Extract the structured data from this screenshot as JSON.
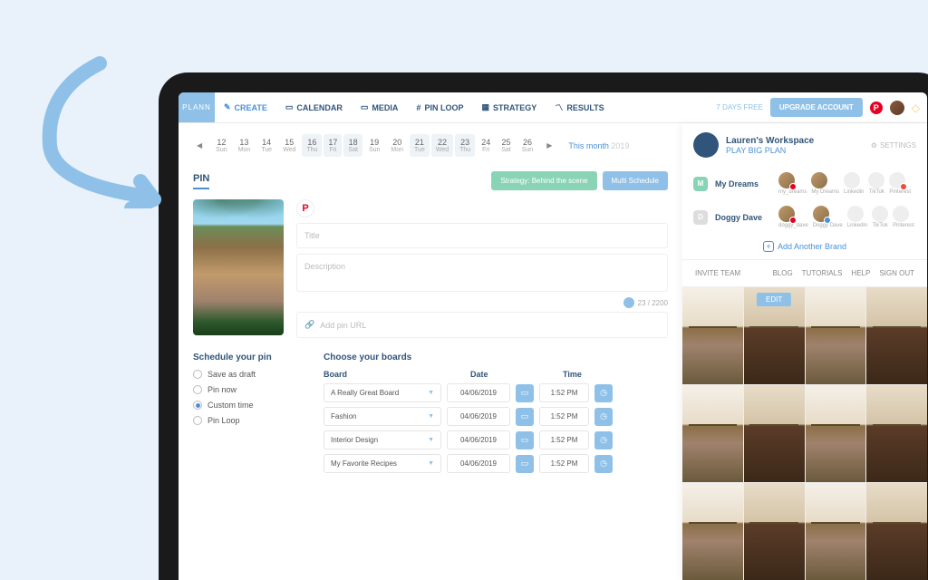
{
  "app": {
    "logo": "PLANN"
  },
  "nav": {
    "create": "CREATE",
    "calendar": "CALENDAR",
    "media": "MEDIA",
    "pinloop": "PIN LOOP",
    "strategy": "STRATEGY",
    "results": "RESULTS"
  },
  "account": {
    "freedays": "7 DAYS FREE",
    "upgrade": "UPGRADE ACCOUNT"
  },
  "dates": {
    "items": [
      {
        "n": "12",
        "d": "Sun"
      },
      {
        "n": "13",
        "d": "Mon"
      },
      {
        "n": "14",
        "d": "Tue"
      },
      {
        "n": "15",
        "d": "Wed"
      },
      {
        "n": "16",
        "d": "Thu",
        "sel": true
      },
      {
        "n": "17",
        "d": "Fri",
        "sel": true
      },
      {
        "n": "18",
        "d": "Sat",
        "sel": true
      },
      {
        "n": "19",
        "d": "Sun"
      },
      {
        "n": "20",
        "d": "Mon"
      },
      {
        "n": "21",
        "d": "Tue",
        "sel": true
      },
      {
        "n": "22",
        "d": "Wed",
        "sel": true
      },
      {
        "n": "23",
        "d": "Thu",
        "sel": true
      },
      {
        "n": "24",
        "d": "Fri"
      },
      {
        "n": "25",
        "d": "Sat"
      },
      {
        "n": "26",
        "d": "Sun"
      }
    ],
    "thismonth": "This month",
    "year": "2019"
  },
  "pin": {
    "heading": "PIN",
    "strategy_btn": "Strategy: Behind the scene",
    "multi_btn": "Multi Schedule",
    "title_ph": "Title",
    "desc_ph": "Description",
    "counter": "23 / 2200",
    "url_ph": "Add pin URL"
  },
  "schedule": {
    "heading": "Schedule your pin",
    "options": [
      "Save as draft",
      "Pin now",
      "Custom time",
      "Pin Loop"
    ],
    "selected": 2
  },
  "boards": {
    "heading": "Choose your boards",
    "cols": {
      "board": "Board",
      "date": "Date",
      "time": "Time"
    },
    "rows": [
      {
        "board": "A Really Great Board",
        "date": "04/06/2019",
        "time": "1:52 PM"
      },
      {
        "board": "Fashion",
        "date": "04/06/2019",
        "time": "1:52 PM"
      },
      {
        "board": "Interior Design",
        "date": "04/06/2019",
        "time": "1:52 PM"
      },
      {
        "board": "My Favorite Recipes",
        "date": "04/06/2019",
        "time": "1:52 PM"
      }
    ]
  },
  "workspace": {
    "name": "Lauren's Workspace",
    "plan": "PLAY BIG PLAN",
    "settings": "SETTINGS",
    "brands": [
      {
        "letter": "M",
        "name": "My Dreams",
        "cls": "g",
        "socials": [
          {
            "l": "my_dreams",
            "a": true,
            "b": "pk"
          },
          {
            "l": "My Dreams",
            "a": true
          },
          {
            "l": "Linkedin"
          },
          {
            "l": "TikTok"
          },
          {
            "l": "Pinterest",
            "b": "rd"
          }
        ]
      },
      {
        "letter": "D",
        "name": "Doggy Dave",
        "cls": "y",
        "socials": [
          {
            "l": "doggy_dave",
            "a": true,
            "b": "pk"
          },
          {
            "l": "Doggy Dave",
            "a": true,
            "b": "bl"
          },
          {
            "l": "Linkedin"
          },
          {
            "l": "TikTok"
          },
          {
            "l": "Pinterest"
          }
        ]
      }
    ],
    "add": "Add Another Brand"
  },
  "rlinks": {
    "invite": "INVITE TEAM",
    "blog": "BLOG",
    "tutorials": "TUTORIALS",
    "help": "HELP",
    "signout": "SIGN OUT"
  },
  "grid": {
    "edit": "EDIT"
  }
}
